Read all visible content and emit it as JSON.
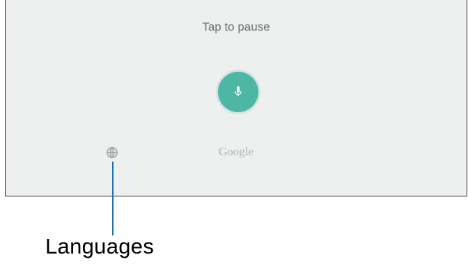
{
  "voice_panel": {
    "status_text": "Tap to pause",
    "mic_button_icon": "microphone-icon",
    "language_icon": "globe-icon",
    "brand_text": "Google",
    "accent_color": "#4db6a4",
    "background_color": "#eeefef"
  },
  "annotation": {
    "label": "Languages",
    "line_color": "#1f6fb0"
  }
}
